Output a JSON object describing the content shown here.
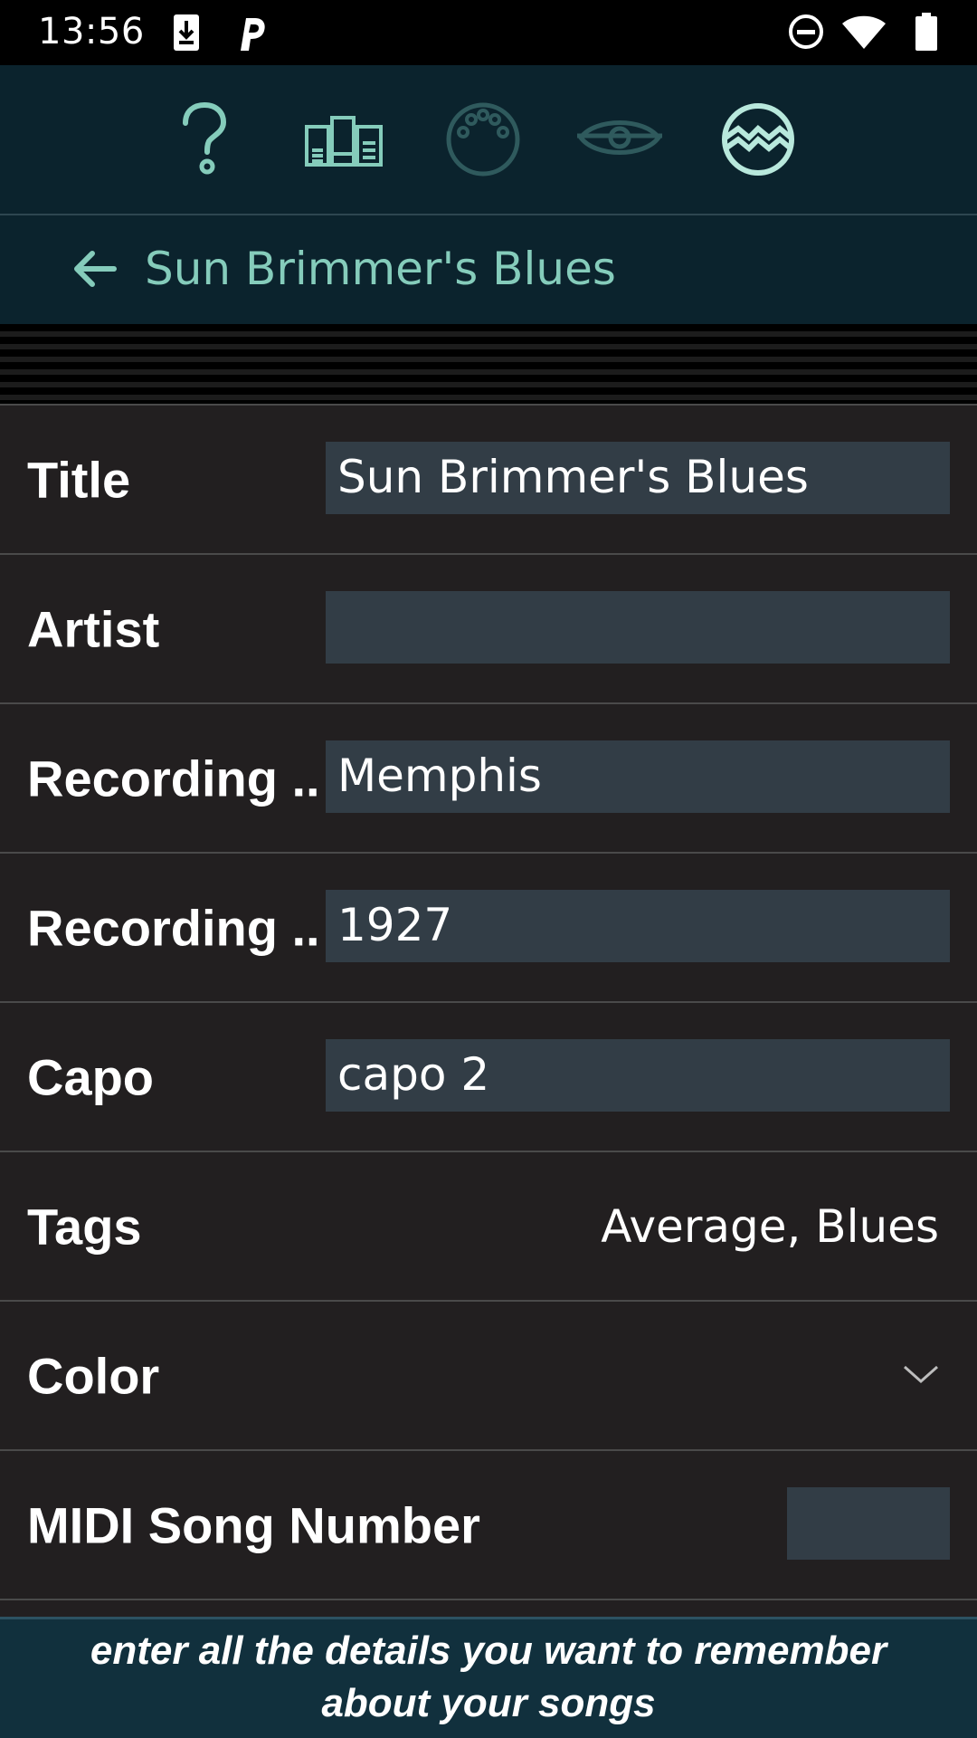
{
  "status_bar": {
    "time": "13:56",
    "left_icons": [
      "download-icon",
      "parking-icon"
    ],
    "right_icons": [
      "do-not-disturb-icon",
      "wifi-icon",
      "battery-icon"
    ]
  },
  "toolbar": {
    "icons": [
      "help-icon",
      "song-library-icon",
      "midi-icon",
      "eye-icon",
      "app-logo-icon"
    ]
  },
  "header": {
    "back_icon": "back-arrow-icon",
    "title": "Sun Brimmer's Blues"
  },
  "form": {
    "title_label": "Title",
    "title_value": "Sun Brimmer's Blues",
    "artist_label": "Artist",
    "artist_value": "",
    "recording_location_label": "Recording ...",
    "recording_location_value": "Memphis",
    "recording_year_label": "Recording ...",
    "recording_year_value": "1927",
    "capo_label": "Capo",
    "capo_value": "capo 2",
    "tags_label": "Tags",
    "tags_value": "Average, Blues",
    "color_label": "Color",
    "midi_label": "MIDI Song Number",
    "midi_value": ""
  },
  "footer": {
    "line1": "enter all the details you want to remember",
    "line2": "about your songs"
  },
  "colors": {
    "accent": "#85ccbb",
    "toolbar_bg": "#0b232d",
    "field_bg": "#323d46",
    "page_bg": "#221f20"
  }
}
